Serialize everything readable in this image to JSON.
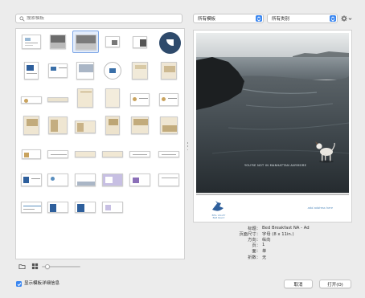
{
  "search": {
    "placeholder": "搜索模板"
  },
  "filters": {
    "templates_value": "所有模板",
    "categories_value": "所有类别"
  },
  "photo_caption": "YOU'RE NOT IN MANHATTAN ANYMORE",
  "ad": {
    "brand_name": "BELL VALLEY",
    "brand_sub": "B&B Resort",
    "right_text": "add address here"
  },
  "info": [
    {
      "key": "标题：",
      "value": "Bed Breakfast NA - Ad"
    },
    {
      "key": "页面尺寸：",
      "value": "字母 (8 x 11in.)"
    },
    {
      "key": "方向：",
      "value": "纵向"
    },
    {
      "key": "页：",
      "value": "1"
    },
    {
      "key": "面：",
      "value": "单"
    },
    {
      "key": "折数：",
      "value": "无"
    }
  ],
  "footer": {
    "show_details_label": "显示模板详细信息",
    "show_details_checked": true,
    "cancel_label": "取消",
    "open_label": "打开(O)"
  },
  "colors": {
    "accent": "#3a86f0",
    "selection": "#7fa7e6"
  },
  "icons": {
    "search": "search-icon",
    "gear": "gear-icon",
    "folder": "folder-icon",
    "grid": "grid-view-icon"
  }
}
